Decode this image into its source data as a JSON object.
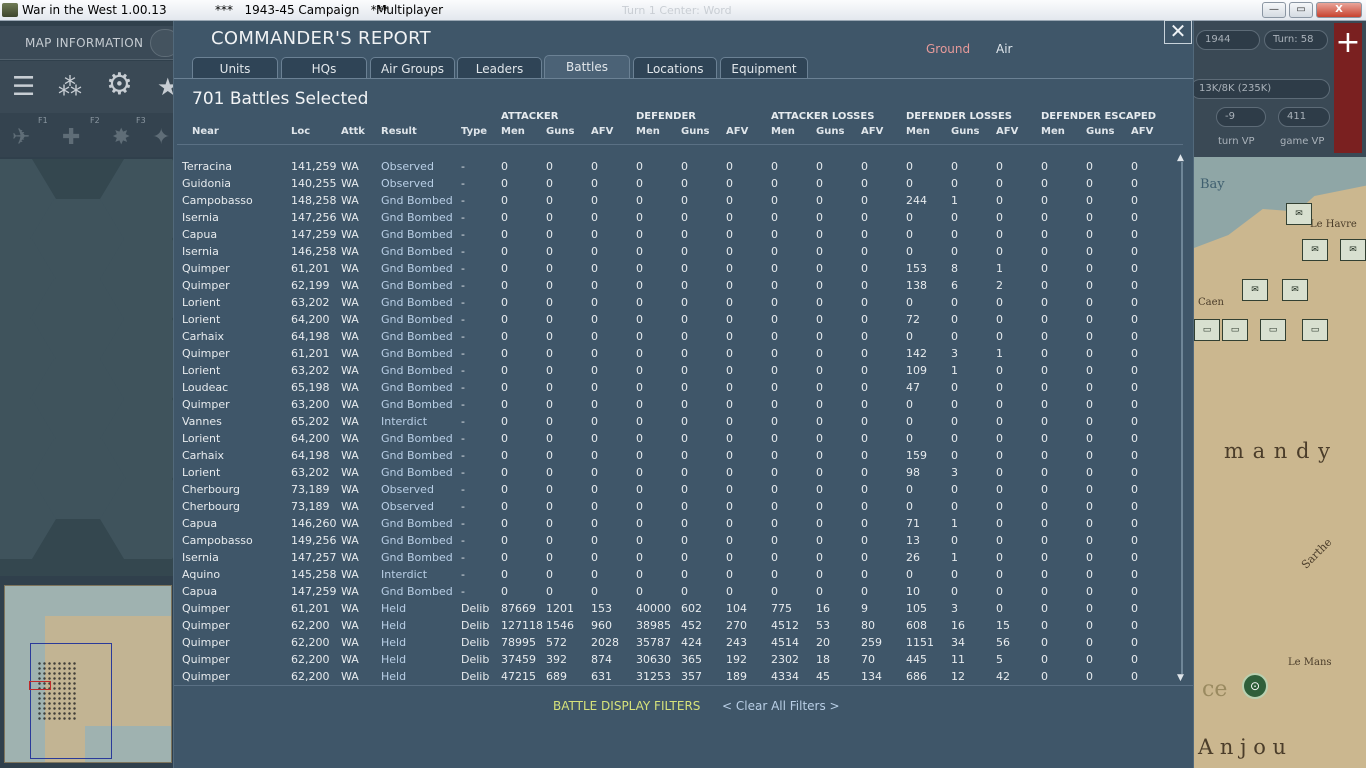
{
  "window": {
    "title": "War in the West 1.00.13",
    "campaign": "***   1943-45 Campaign   ***",
    "mode": "Multiplayer",
    "ghost_title": "Turn 1 Center: Word",
    "buttons": {
      "minimize": "—",
      "maximize": "▭",
      "close": "X"
    }
  },
  "left_panel": {
    "map_information_label": "MAP INFORMATION",
    "hotkeys": [
      "F1",
      "F2",
      "F3"
    ]
  },
  "right_panel": {
    "date": "1944",
    "turn": "Turn: 58",
    "strength": "13K/8K (235K)",
    "vp_value": "-9",
    "game_vp_value": "411",
    "turn_vp_label": "turn VP",
    "game_vp_label": "game VP",
    "map_labels": {
      "bay": "Bay",
      "le_havre": "Le Havre",
      "caen": "Caen",
      "mandy": "m a n d y",
      "le_mans": "Le Mans",
      "anjou": "A n j o u",
      "sarthe": "Sarthe",
      "ce": "ce"
    }
  },
  "report": {
    "title": "COMMANDER'S REPORT",
    "toggles": {
      "ground": "Ground",
      "air": "Air"
    },
    "close": "✕",
    "tabs": [
      "Units",
      "HQs",
      "Air Groups",
      "Leaders",
      "Battles",
      "Locations",
      "Equipment"
    ],
    "active_tab": "Battles",
    "selected_count": "701 Battles Selected",
    "groups": {
      "attacker": "ATTACKER",
      "defender": "DEFENDER",
      "attacker_losses": "ATTACKER LOSSES",
      "defender_losses": "DEFENDER LOSSES",
      "defender_escaped": "DEFENDER ESCAPED"
    },
    "columns": {
      "near": "Near",
      "loc": "Loc",
      "attk": "Attk",
      "result": "Result",
      "type": "Type",
      "men": "Men",
      "guns": "Guns",
      "afv": "AFV"
    },
    "filters_label": "BATTLE DISPLAY FILTERS",
    "clear_filters_label": "< Clear All Filters >"
  },
  "battles": [
    {
      "near": "Terracina",
      "loc": "141,259",
      "attk": "WA",
      "result": "Observed",
      "type": "-",
      "am": "0",
      "ag": "0",
      "aa": "0",
      "dm": "0",
      "dg": "0",
      "da": "0",
      "alm": "0",
      "alg": "0",
      "ala": "0",
      "dlm": "0",
      "dlg": "0",
      "dla": "0",
      "em": "0",
      "eg": "0",
      "ea": "0"
    },
    {
      "near": "Guidonia",
      "loc": "140,255",
      "attk": "WA",
      "result": "Observed",
      "type": "-",
      "am": "0",
      "ag": "0",
      "aa": "0",
      "dm": "0",
      "dg": "0",
      "da": "0",
      "alm": "0",
      "alg": "0",
      "ala": "0",
      "dlm": "0",
      "dlg": "0",
      "dla": "0",
      "em": "0",
      "eg": "0",
      "ea": "0"
    },
    {
      "near": "Campobasso",
      "loc": "148,258",
      "attk": "WA",
      "result": "Gnd Bombed",
      "type": "-",
      "am": "0",
      "ag": "0",
      "aa": "0",
      "dm": "0",
      "dg": "0",
      "da": "0",
      "alm": "0",
      "alg": "0",
      "ala": "0",
      "dlm": "244",
      "dlg": "1",
      "dla": "0",
      "em": "0",
      "eg": "0",
      "ea": "0"
    },
    {
      "near": "Isernia",
      "loc": "147,256",
      "attk": "WA",
      "result": "Gnd Bombed",
      "type": "-",
      "am": "0",
      "ag": "0",
      "aa": "0",
      "dm": "0",
      "dg": "0",
      "da": "0",
      "alm": "0",
      "alg": "0",
      "ala": "0",
      "dlm": "0",
      "dlg": "0",
      "dla": "0",
      "em": "0",
      "eg": "0",
      "ea": "0"
    },
    {
      "near": "Capua",
      "loc": "147,259",
      "attk": "WA",
      "result": "Gnd Bombed",
      "type": "-",
      "am": "0",
      "ag": "0",
      "aa": "0",
      "dm": "0",
      "dg": "0",
      "da": "0",
      "alm": "0",
      "alg": "0",
      "ala": "0",
      "dlm": "0",
      "dlg": "0",
      "dla": "0",
      "em": "0",
      "eg": "0",
      "ea": "0"
    },
    {
      "near": "Isernia",
      "loc": "146,258",
      "attk": "WA",
      "result": "Gnd Bombed",
      "type": "-",
      "am": "0",
      "ag": "0",
      "aa": "0",
      "dm": "0",
      "dg": "0",
      "da": "0",
      "alm": "0",
      "alg": "0",
      "ala": "0",
      "dlm": "0",
      "dlg": "0",
      "dla": "0",
      "em": "0",
      "eg": "0",
      "ea": "0"
    },
    {
      "near": "Quimper",
      "loc": "61,201",
      "attk": "WA",
      "result": "Gnd Bombed",
      "type": "-",
      "am": "0",
      "ag": "0",
      "aa": "0",
      "dm": "0",
      "dg": "0",
      "da": "0",
      "alm": "0",
      "alg": "0",
      "ala": "0",
      "dlm": "153",
      "dlg": "8",
      "dla": "1",
      "em": "0",
      "eg": "0",
      "ea": "0"
    },
    {
      "near": "Quimper",
      "loc": "62,199",
      "attk": "WA",
      "result": "Gnd Bombed",
      "type": "-",
      "am": "0",
      "ag": "0",
      "aa": "0",
      "dm": "0",
      "dg": "0",
      "da": "0",
      "alm": "0",
      "alg": "0",
      "ala": "0",
      "dlm": "138",
      "dlg": "6",
      "dla": "2",
      "em": "0",
      "eg": "0",
      "ea": "0"
    },
    {
      "near": "Lorient",
      "loc": "63,202",
      "attk": "WA",
      "result": "Gnd Bombed",
      "type": "-",
      "am": "0",
      "ag": "0",
      "aa": "0",
      "dm": "0",
      "dg": "0",
      "da": "0",
      "alm": "0",
      "alg": "0",
      "ala": "0",
      "dlm": "0",
      "dlg": "0",
      "dla": "0",
      "em": "0",
      "eg": "0",
      "ea": "0"
    },
    {
      "near": "Lorient",
      "loc": "64,200",
      "attk": "WA",
      "result": "Gnd Bombed",
      "type": "-",
      "am": "0",
      "ag": "0",
      "aa": "0",
      "dm": "0",
      "dg": "0",
      "da": "0",
      "alm": "0",
      "alg": "0",
      "ala": "0",
      "dlm": "72",
      "dlg": "0",
      "dla": "0",
      "em": "0",
      "eg": "0",
      "ea": "0"
    },
    {
      "near": "Carhaix",
      "loc": "64,198",
      "attk": "WA",
      "result": "Gnd Bombed",
      "type": "-",
      "am": "0",
      "ag": "0",
      "aa": "0",
      "dm": "0",
      "dg": "0",
      "da": "0",
      "alm": "0",
      "alg": "0",
      "ala": "0",
      "dlm": "0",
      "dlg": "0",
      "dla": "0",
      "em": "0",
      "eg": "0",
      "ea": "0"
    },
    {
      "near": "Quimper",
      "loc": "61,201",
      "attk": "WA",
      "result": "Gnd Bombed",
      "type": "-",
      "am": "0",
      "ag": "0",
      "aa": "0",
      "dm": "0",
      "dg": "0",
      "da": "0",
      "alm": "0",
      "alg": "0",
      "ala": "0",
      "dlm": "142",
      "dlg": "3",
      "dla": "1",
      "em": "0",
      "eg": "0",
      "ea": "0"
    },
    {
      "near": "Lorient",
      "loc": "63,202",
      "attk": "WA",
      "result": "Gnd Bombed",
      "type": "-",
      "am": "0",
      "ag": "0",
      "aa": "0",
      "dm": "0",
      "dg": "0",
      "da": "0",
      "alm": "0",
      "alg": "0",
      "ala": "0",
      "dlm": "109",
      "dlg": "1",
      "dla": "0",
      "em": "0",
      "eg": "0",
      "ea": "0"
    },
    {
      "near": "Loudeac",
      "loc": "65,198",
      "attk": "WA",
      "result": "Gnd Bombed",
      "type": "-",
      "am": "0",
      "ag": "0",
      "aa": "0",
      "dm": "0",
      "dg": "0",
      "da": "0",
      "alm": "0",
      "alg": "0",
      "ala": "0",
      "dlm": "47",
      "dlg": "0",
      "dla": "0",
      "em": "0",
      "eg": "0",
      "ea": "0"
    },
    {
      "near": "Quimper",
      "loc": "63,200",
      "attk": "WA",
      "result": "Gnd Bombed",
      "type": "-",
      "am": "0",
      "ag": "0",
      "aa": "0",
      "dm": "0",
      "dg": "0",
      "da": "0",
      "alm": "0",
      "alg": "0",
      "ala": "0",
      "dlm": "0",
      "dlg": "0",
      "dla": "0",
      "em": "0",
      "eg": "0",
      "ea": "0"
    },
    {
      "near": "Vannes",
      "loc": "65,202",
      "attk": "WA",
      "result": "Interdict",
      "type": "-",
      "am": "0",
      "ag": "0",
      "aa": "0",
      "dm": "0",
      "dg": "0",
      "da": "0",
      "alm": "0",
      "alg": "0",
      "ala": "0",
      "dlm": "0",
      "dlg": "0",
      "dla": "0",
      "em": "0",
      "eg": "0",
      "ea": "0"
    },
    {
      "near": "Lorient",
      "loc": "64,200",
      "attk": "WA",
      "result": "Gnd Bombed",
      "type": "-",
      "am": "0",
      "ag": "0",
      "aa": "0",
      "dm": "0",
      "dg": "0",
      "da": "0",
      "alm": "0",
      "alg": "0",
      "ala": "0",
      "dlm": "0",
      "dlg": "0",
      "dla": "0",
      "em": "0",
      "eg": "0",
      "ea": "0"
    },
    {
      "near": "Carhaix",
      "loc": "64,198",
      "attk": "WA",
      "result": "Gnd Bombed",
      "type": "-",
      "am": "0",
      "ag": "0",
      "aa": "0",
      "dm": "0",
      "dg": "0",
      "da": "0",
      "alm": "0",
      "alg": "0",
      "ala": "0",
      "dlm": "159",
      "dlg": "0",
      "dla": "0",
      "em": "0",
      "eg": "0",
      "ea": "0"
    },
    {
      "near": "Lorient",
      "loc": "63,202",
      "attk": "WA",
      "result": "Gnd Bombed",
      "type": "-",
      "am": "0",
      "ag": "0",
      "aa": "0",
      "dm": "0",
      "dg": "0",
      "da": "0",
      "alm": "0",
      "alg": "0",
      "ala": "0",
      "dlm": "98",
      "dlg": "3",
      "dla": "0",
      "em": "0",
      "eg": "0",
      "ea": "0"
    },
    {
      "near": "Cherbourg",
      "loc": "73,189",
      "attk": "WA",
      "result": "Observed",
      "type": "-",
      "am": "0",
      "ag": "0",
      "aa": "0",
      "dm": "0",
      "dg": "0",
      "da": "0",
      "alm": "0",
      "alg": "0",
      "ala": "0",
      "dlm": "0",
      "dlg": "0",
      "dla": "0",
      "em": "0",
      "eg": "0",
      "ea": "0"
    },
    {
      "near": "Cherbourg",
      "loc": "73,189",
      "attk": "WA",
      "result": "Observed",
      "type": "-",
      "am": "0",
      "ag": "0",
      "aa": "0",
      "dm": "0",
      "dg": "0",
      "da": "0",
      "alm": "0",
      "alg": "0",
      "ala": "0",
      "dlm": "0",
      "dlg": "0",
      "dla": "0",
      "em": "0",
      "eg": "0",
      "ea": "0"
    },
    {
      "near": "Capua",
      "loc": "146,260",
      "attk": "WA",
      "result": "Gnd Bombed",
      "type": "-",
      "am": "0",
      "ag": "0",
      "aa": "0",
      "dm": "0",
      "dg": "0",
      "da": "0",
      "alm": "0",
      "alg": "0",
      "ala": "0",
      "dlm": "71",
      "dlg": "1",
      "dla": "0",
      "em": "0",
      "eg": "0",
      "ea": "0"
    },
    {
      "near": "Campobasso",
      "loc": "149,256",
      "attk": "WA",
      "result": "Gnd Bombed",
      "type": "-",
      "am": "0",
      "ag": "0",
      "aa": "0",
      "dm": "0",
      "dg": "0",
      "da": "0",
      "alm": "0",
      "alg": "0",
      "ala": "0",
      "dlm": "13",
      "dlg": "0",
      "dla": "0",
      "em": "0",
      "eg": "0",
      "ea": "0"
    },
    {
      "near": "Isernia",
      "loc": "147,257",
      "attk": "WA",
      "result": "Gnd Bombed",
      "type": "-",
      "am": "0",
      "ag": "0",
      "aa": "0",
      "dm": "0",
      "dg": "0",
      "da": "0",
      "alm": "0",
      "alg": "0",
      "ala": "0",
      "dlm": "26",
      "dlg": "1",
      "dla": "0",
      "em": "0",
      "eg": "0",
      "ea": "0"
    },
    {
      "near": "Aquino",
      "loc": "145,258",
      "attk": "WA",
      "result": "Interdict",
      "type": "-",
      "am": "0",
      "ag": "0",
      "aa": "0",
      "dm": "0",
      "dg": "0",
      "da": "0",
      "alm": "0",
      "alg": "0",
      "ala": "0",
      "dlm": "0",
      "dlg": "0",
      "dla": "0",
      "em": "0",
      "eg": "0",
      "ea": "0"
    },
    {
      "near": "Capua",
      "loc": "147,259",
      "attk": "WA",
      "result": "Gnd Bombed",
      "type": "-",
      "am": "0",
      "ag": "0",
      "aa": "0",
      "dm": "0",
      "dg": "0",
      "da": "0",
      "alm": "0",
      "alg": "0",
      "ala": "0",
      "dlm": "10",
      "dlg": "0",
      "dla": "0",
      "em": "0",
      "eg": "0",
      "ea": "0"
    },
    {
      "near": "Quimper",
      "loc": "61,201",
      "attk": "WA",
      "result": "Held",
      "type": "Delib",
      "am": "87669",
      "ag": "1201",
      "aa": "153",
      "dm": "40000",
      "dg": "602",
      "da": "104",
      "alm": "775",
      "alg": "16",
      "ala": "9",
      "dlm": "105",
      "dlg": "3",
      "dla": "0",
      "em": "0",
      "eg": "0",
      "ea": "0"
    },
    {
      "near": "Quimper",
      "loc": "62,200",
      "attk": "WA",
      "result": "Held",
      "type": "Delib",
      "am": "127118",
      "ag": "1546",
      "aa": "960",
      "dm": "38985",
      "dg": "452",
      "da": "270",
      "alm": "4512",
      "alg": "53",
      "ala": "80",
      "dlm": "608",
      "dlg": "16",
      "dla": "15",
      "em": "0",
      "eg": "0",
      "ea": "0"
    },
    {
      "near": "Quimper",
      "loc": "62,200",
      "attk": "WA",
      "result": "Held",
      "type": "Delib",
      "am": "78995",
      "ag": "572",
      "aa": "2028",
      "dm": "35787",
      "dg": "424",
      "da": "243",
      "alm": "4514",
      "alg": "20",
      "ala": "259",
      "dlm": "1151",
      "dlg": "34",
      "dla": "56",
      "em": "0",
      "eg": "0",
      "ea": "0"
    },
    {
      "near": "Quimper",
      "loc": "62,200",
      "attk": "WA",
      "result": "Held",
      "type": "Delib",
      "am": "37459",
      "ag": "392",
      "aa": "874",
      "dm": "30630",
      "dg": "365",
      "da": "192",
      "alm": "2302",
      "alg": "18",
      "ala": "70",
      "dlm": "445",
      "dlg": "11",
      "dla": "5",
      "em": "0",
      "eg": "0",
      "ea": "0"
    },
    {
      "near": "Quimper",
      "loc": "62,200",
      "attk": "WA",
      "result": "Held",
      "type": "Delib",
      "am": "47215",
      "ag": "689",
      "aa": "631",
      "dm": "31253",
      "dg": "357",
      "da": "189",
      "alm": "4334",
      "alg": "45",
      "ala": "134",
      "dlm": "686",
      "dlg": "12",
      "dla": "42",
      "em": "0",
      "eg": "0",
      "ea": "0"
    }
  ],
  "colors": {
    "ground": "#e69a9a",
    "air": "#dfe6ec",
    "result": "#b9cfe6",
    "filters": "#d6e27a"
  }
}
